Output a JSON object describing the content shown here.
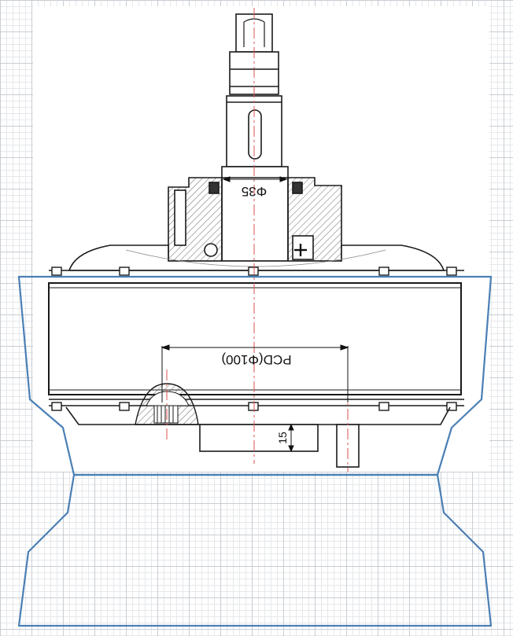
{
  "dimensions": {
    "shaft_diameter": "Φ35",
    "pcd": "PCD(Φ100)",
    "offset": "15"
  },
  "colors": {
    "grid_major": "#c9cdd3",
    "grid_minor": "#e6e8eb",
    "ink": "#1a1a1a",
    "centerline": "#d9534f",
    "overlay": "#4a7fb5"
  }
}
